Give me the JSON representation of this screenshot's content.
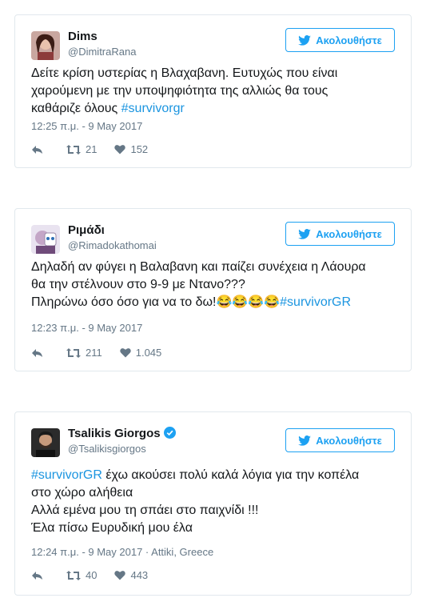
{
  "tweets": [
    {
      "name": "Dims",
      "handle": "@DimitraRana",
      "follow_label": "Ακολουθήστε",
      "lines": [
        "Δείτε κρίση υστερίας η Βλαχαβανη. Ευτυχώς που είναι",
        "χαρούμενη με την υποψηφιότητα της αλλιώς θα τους",
        "καθάριζε όλους "
      ],
      "hashtag": "#survivorgr",
      "timestamp": "12:25 π.μ. - 9 May 2017",
      "retweets": "21",
      "likes": "152"
    },
    {
      "name": "Ριμάδι",
      "handle": "@Rimadokathomai",
      "follow_label": "Ακολουθήστε",
      "lines": [
        "Δηλαδή αν φύγει η Βαλαβανη και παίζει συνέχεια η Λάουρα",
        "θα την στέλνουν στο 9-9 με Ντανο???",
        "Πληρώνω όσο όσο για να το δω!"
      ],
      "emoji": "😂😂😂😂",
      "hashtag": "#survivorGR",
      "timestamp": "12:23 π.μ. - 9 May 2017",
      "retweets": "211",
      "likes": "1.045"
    },
    {
      "name": "Tsalikis Giorgos",
      "handle": "@Tsalikisgiorgos",
      "follow_label": "Ακολουθήστε",
      "hashtag": "#survivorGR",
      "lines": [
        " έχω ακούσει πολύ καλά λόγια για την κοπέλα",
        "στο χώρο αλήθεια",
        "Αλλά εμένα μου τη σπάει στο παιχνίδι !!!",
        "Έλα πίσω Ευρυδική μου έλα"
      ],
      "timestamp": "12:24 π.μ. - 9 May 2017 · Attiki, Greece",
      "retweets": "40",
      "likes": "443"
    }
  ],
  "colors": {
    "accent": "#1da1f2",
    "hashtag": "#1b95e0",
    "muted": "#657786",
    "border": "#e1e8ed"
  },
  "icons": [
    "twitter-bird-icon",
    "reply-icon",
    "retweet-icon",
    "heart-icon",
    "verified-badge-icon"
  ]
}
